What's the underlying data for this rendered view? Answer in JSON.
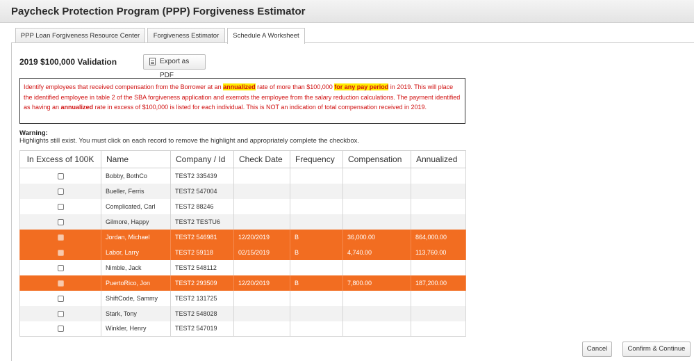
{
  "window": {
    "title": "Paycheck Protection Program (PPP) Forgiveness Estimator"
  },
  "tabs": [
    {
      "label": "PPP Loan Forgiveness Resource Center",
      "active": false
    },
    {
      "label": "Forgiveness Estimator",
      "active": false
    },
    {
      "label": "Schedule A Worksheet",
      "active": true
    }
  ],
  "section": {
    "title": "2019 $100,000 Validation",
    "export_label": "Export as PDF"
  },
  "notice": {
    "p1": "Identify employees that received compensation from the Borrower at an ",
    "hl1": "annualized",
    "p2": " rate of more than $100,000 ",
    "hl2": "for any pay period",
    "p3": " in 2019. This will place the identified employee in table 2 of the SBA forgiveness application and exemots the employee from the salary reduction calculations. The payment identified as having an ",
    "b1": "annualized",
    "p4": " rate in excess of $100,000 is listed for each individual. This is NOT an indication of total compensation received in 2019."
  },
  "warning": {
    "title": "Warning:",
    "text": "Highlights still exist. You must click on each record to remove the highlight and appropriately complete the checkbox."
  },
  "table": {
    "headers": [
      "In Excess of 100K",
      "Name",
      "Company / Id",
      "Check Date",
      "Frequency",
      "Compensation",
      "Annualized"
    ],
    "rows": [
      {
        "name": "Bobby, BothCo",
        "company": "TEST2 335439",
        "date": "",
        "freq": "",
        "comp": "",
        "annual": "",
        "highlight": false
      },
      {
        "name": "Bueller, Ferris",
        "company": "TEST2 547004",
        "date": "",
        "freq": "",
        "comp": "",
        "annual": "",
        "highlight": false
      },
      {
        "name": "Complicated, Carl",
        "company": "TEST2 88246",
        "date": "",
        "freq": "",
        "comp": "",
        "annual": "",
        "highlight": false
      },
      {
        "name": "Gilmore, Happy",
        "company": "TEST2 TESTU6",
        "date": "",
        "freq": "",
        "comp": "",
        "annual": "",
        "highlight": false
      },
      {
        "name": "Jordan, Michael",
        "company": "TEST2 546981",
        "date": "12/20/2019",
        "freq": "B",
        "comp": "36,000.00",
        "annual": "864,000.00",
        "highlight": true
      },
      {
        "name": "Labor, Larry",
        "company": "TEST2 59118",
        "date": "02/15/2019",
        "freq": "B",
        "comp": "4,740.00",
        "annual": "113,760.00",
        "highlight": true
      },
      {
        "name": "Nimble, Jack",
        "company": "TEST2 548112",
        "date": "",
        "freq": "",
        "comp": "",
        "annual": "",
        "highlight": false
      },
      {
        "name": "PuertoRico, Jon",
        "company": "TEST2 293509",
        "date": "12/20/2019",
        "freq": "B",
        "comp": "7,800.00",
        "annual": "187,200.00",
        "highlight": true
      },
      {
        "name": "ShiftCode, Sammy",
        "company": "TEST2 131725",
        "date": "",
        "freq": "",
        "comp": "",
        "annual": "",
        "highlight": false
      },
      {
        "name": "Stark, Tony",
        "company": "TEST2 548028",
        "date": "",
        "freq": "",
        "comp": "",
        "annual": "",
        "highlight": false
      },
      {
        "name": "Winkler, Henry",
        "company": "TEST2 547019",
        "date": "",
        "freq": "",
        "comp": "",
        "annual": "",
        "highlight": false
      }
    ]
  },
  "buttons": {
    "cancel": "Cancel",
    "confirm": "Confirm & Continue"
  },
  "colors": {
    "highlight_row": "#f26d21",
    "notice_text": "#d01010",
    "notice_highlight": "#ffeb00"
  }
}
